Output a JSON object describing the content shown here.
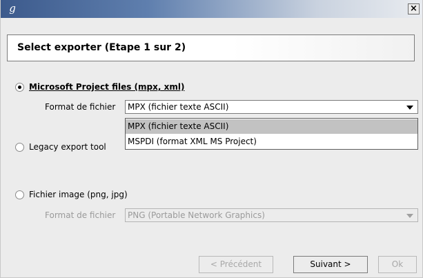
{
  "window": {
    "icon": "app-logo-icon",
    "icon_glyph": "g",
    "close_glyph": "×"
  },
  "header": {
    "title": "Select exporter  (Etape 1 sur 2)"
  },
  "options": [
    {
      "label": "Microsoft Project files (mpx, xml)",
      "selected": true,
      "format_label": "Format de fichier",
      "format_value": "MPX (fichier texte ASCII)",
      "enabled": true
    },
    {
      "label": "Legacy export tool",
      "selected": false
    },
    {
      "label": "Fichier image (png, jpg)",
      "selected": false,
      "format_label": "Format de fichier",
      "format_value": "PNG (Portable Network Graphics)",
      "enabled": false
    }
  ],
  "dropdown": {
    "items": [
      "MPX (fichier texte ASCII)",
      "MSPDI (format XML MS Project)"
    ],
    "highlighted_index": 0
  },
  "buttons": {
    "previous": "< Précédent",
    "next": "Suivant >",
    "ok": "Ok"
  }
}
